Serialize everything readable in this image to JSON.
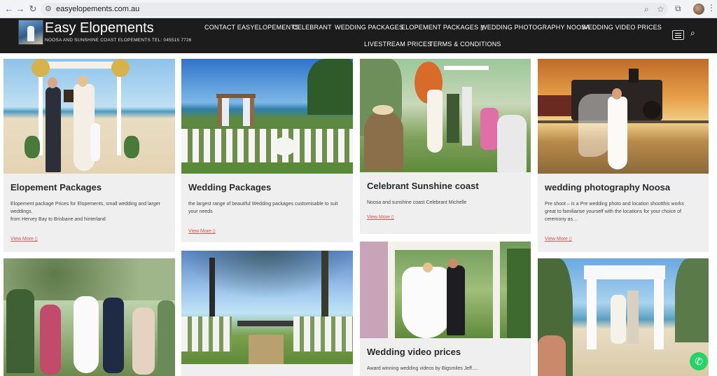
{
  "browser": {
    "url": "easyelopements.com.au",
    "back_icon": "arrow-left-icon",
    "forward_icon": "arrow-right-icon",
    "reload_icon": "reload-icon"
  },
  "header": {
    "title": "Easy Elopements",
    "subtitle": "NOOSA AND SUNSHINE COAST ELOPEMENTS TEL: 045515 7726",
    "nav": [
      "CONTACT EASYELOPEMENTS",
      "CELEBRANT",
      "WEDDING PACKAGES",
      "ELOPEMENT PACKAGES ▯",
      "WEDDING PHOTOGRAPHY NOOSA",
      "WEDDING VIDEO PRICES",
      "LIVESTREAM PRICES",
      "TERMS & CONDITIONS"
    ]
  },
  "cards": [
    {
      "title": "Elopement Packages",
      "text1": "Elopement package Prices for Elopements, small wedding and larger",
      "text2": "weddings.",
      "text3": "from Hervey Bay to Brisbane and hinterland",
      "view_more": "View More ▯"
    },
    {
      "title": "Wedding Packages",
      "text1": "the largest range of beautiful Wedding packages customisable to suit",
      "text2": "your needs",
      "view_more": "View More ▯"
    },
    {
      "title": "Celebrant Sunshine coast",
      "text1": "Noosa and sunshine coast Celebrant Michelle",
      "view_more": "View More ▯"
    },
    {
      "title": "wedding photography Noosa",
      "text1": "Pre shoot – is a Pre wedding photo and location shootthis works",
      "text2": "great to familiarise yourself with the locations for your choice of",
      "text3": "ceremony as…",
      "view_more": "View More ▯"
    },
    {
      "title": "Wedding video prices",
      "text1": "Award winning wedding videos by Bigsmiles Jeff…."
    }
  ],
  "colors": {
    "header_bg": "#1c1c1c",
    "card_bg": "#efefef",
    "link": "#d9534f",
    "whatsapp": "#25d366"
  }
}
